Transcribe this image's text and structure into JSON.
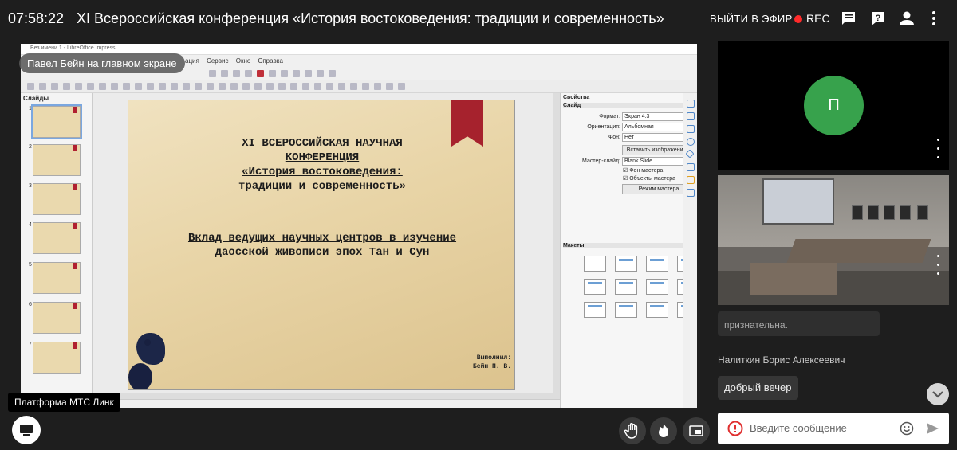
{
  "header": {
    "clock": "07:58:22",
    "conference_title": "XI Всероссийская конференция «История востоковедения: традиции и современность»",
    "go_live_label": "ВЫЙТИ В ЭФИР",
    "rec_label": "REC"
  },
  "screen_share": {
    "presenter_label": "Павел Бейн на главном экране",
    "app_title": "Без имени 1 - LibreOffice Impress",
    "menu": [
      "ация",
      "Сервис",
      "Окно",
      "Справка"
    ],
    "slides_panel_label": "Слайды",
    "slide_numbers": [
      "1",
      "2",
      "3",
      "4",
      "5",
      "6",
      "7"
    ],
    "slide": {
      "title": "XI ВСЕРОССИЙСКАЯ НАУЧНАЯ\nКОНФЕРЕНЦИЯ\n«История востоковедения:\nтрадиции и современность»",
      "subtitle": "Вклад ведущих научных центров в изучение\nдаосской живописи эпох Тан и Сун",
      "author": "Выполнил:\nБейн П. В."
    },
    "properties": {
      "panel_title": "Свойства",
      "section_slide": "Слайд",
      "format_label": "Формат:",
      "format_value": "Экран 4:3",
      "orientation_label": "Ориентация:",
      "orientation_value": "Альбомная",
      "background_label": "Фон:",
      "background_value": "Нет",
      "insert_image_button": "Вставить изображение...",
      "master_slide_label": "Мастер-слайд:",
      "master_slide_value": "Blank Slide",
      "master_background_checkbox": "Фон мастера",
      "master_objects_checkbox": "Объекты мастера",
      "master_mode_button": "Режим мастера",
      "section_layouts": "Макеты"
    }
  },
  "chat": {
    "partial_message": "признательна.",
    "author": "Налиткин Борис Алексеевич",
    "message": "добрый вечер",
    "input_placeholder": "Введите сообщение"
  },
  "participants": {
    "avatar_letter": "П"
  },
  "footer": {
    "platform_tooltip": "Платформа МТС Линк"
  },
  "colors": {
    "background": "#1e1e1e",
    "rec_dot": "#ff2a2a",
    "avatar": "#37a24c",
    "slide_ribbon": "#a6222d"
  }
}
